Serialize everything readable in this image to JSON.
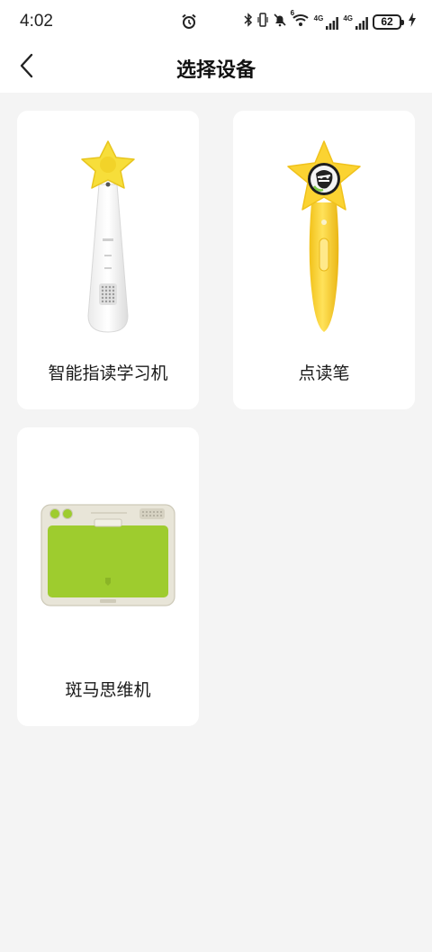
{
  "status_bar": {
    "time": "4:02",
    "signal_1_label": "4G",
    "signal_2_label": "4G",
    "wifi_badge": "6",
    "battery_level": "62",
    "icons": [
      "alarm-icon",
      "bluetooth-icon",
      "vibrate-icon",
      "mute-icon",
      "wifi-icon",
      "signal-icon",
      "signal-icon",
      "battery-icon",
      "charging-icon"
    ]
  },
  "header": {
    "title": "选择设备",
    "back_icon": "chevron-left-icon"
  },
  "devices": [
    {
      "label": "智能指读学习机",
      "image": "smart-reading-device-image"
    },
    {
      "label": "点读笔",
      "image": "reading-pen-image"
    },
    {
      "label": "斑马思维机",
      "image": "zebra-thinking-machine-image"
    }
  ],
  "colors": {
    "background": "#f4f4f4",
    "card": "#ffffff",
    "star_yellow": "#f7de3a",
    "pen_yellow": "#fbd332",
    "tablet_green": "#9ecc2e"
  }
}
